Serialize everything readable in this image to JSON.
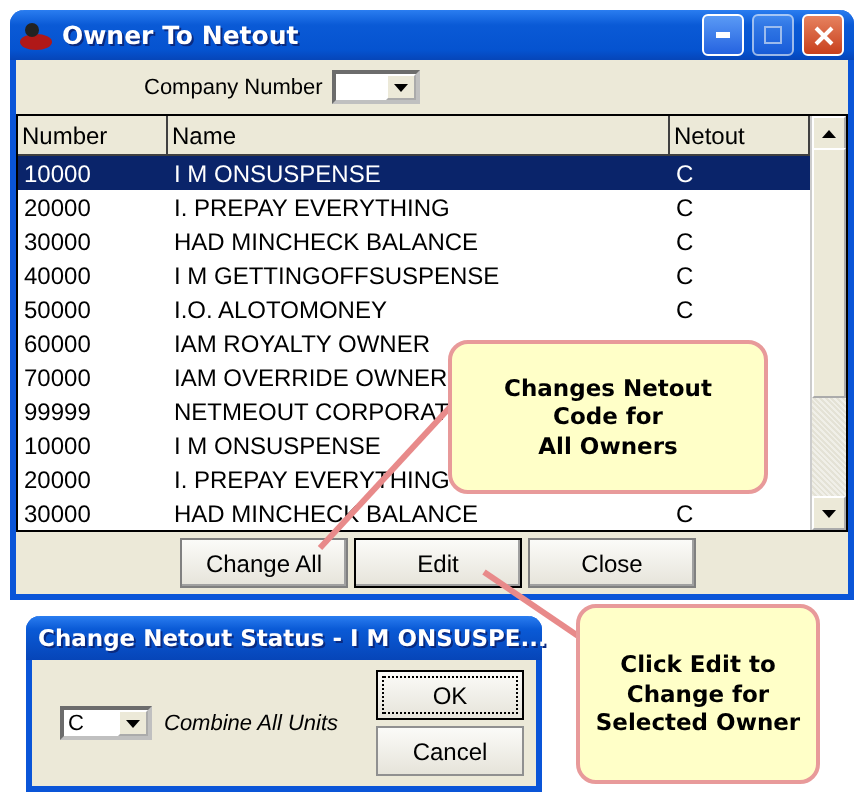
{
  "window": {
    "title": "Owner To Netout"
  },
  "company": {
    "label": "Company Number"
  },
  "table": {
    "columns": [
      "Number",
      "Name",
      "Netout"
    ],
    "rows": [
      {
        "number": "10000",
        "name": "I M ONSUSPENSE",
        "netout": "C",
        "selected": true
      },
      {
        "number": "20000",
        "name": "I. PREPAY EVERYTHING",
        "netout": "C",
        "selected": false
      },
      {
        "number": "30000",
        "name": "HAD MINCHECK BALANCE",
        "netout": "C",
        "selected": false
      },
      {
        "number": "40000",
        "name": "I M GETTINGOFFSUSPENSE",
        "netout": "C",
        "selected": false
      },
      {
        "number": "50000",
        "name": "I.O. ALOTOMONEY",
        "netout": "C",
        "selected": false
      },
      {
        "number": "60000",
        "name": "IAM ROYALTY OWNER",
        "selected": false
      },
      {
        "number": "70000",
        "name": "IAM OVERRIDE OWNER",
        "selected": false
      },
      {
        "number": "99999",
        "name": "NETMEOUT CORPORAT",
        "selected": false
      },
      {
        "number": "10000",
        "name": "I M ONSUSPENSE",
        "selected": false
      },
      {
        "number": "20000",
        "name": "I. PREPAY EVERYTHING",
        "selected": false
      },
      {
        "number": "30000",
        "name": "HAD MINCHECK BALANCE",
        "netout": "C",
        "selected": false
      }
    ]
  },
  "buttons": [
    "Change All",
    "Edit",
    "Close"
  ],
  "dialog": {
    "title": "Change Netout Status - I M ONSUSPE...",
    "value": "C",
    "label": "Combine All Units",
    "buttons": [
      {
        "label": "OK",
        "default": true
      },
      {
        "label": "Cancel",
        "default": false
      }
    ]
  },
  "callouts": [
    {
      "text": "Changes Netout\nCode for\nAll Owners"
    },
    {
      "text": "Click Edit to\nChange for\nSelected Owner"
    }
  ]
}
